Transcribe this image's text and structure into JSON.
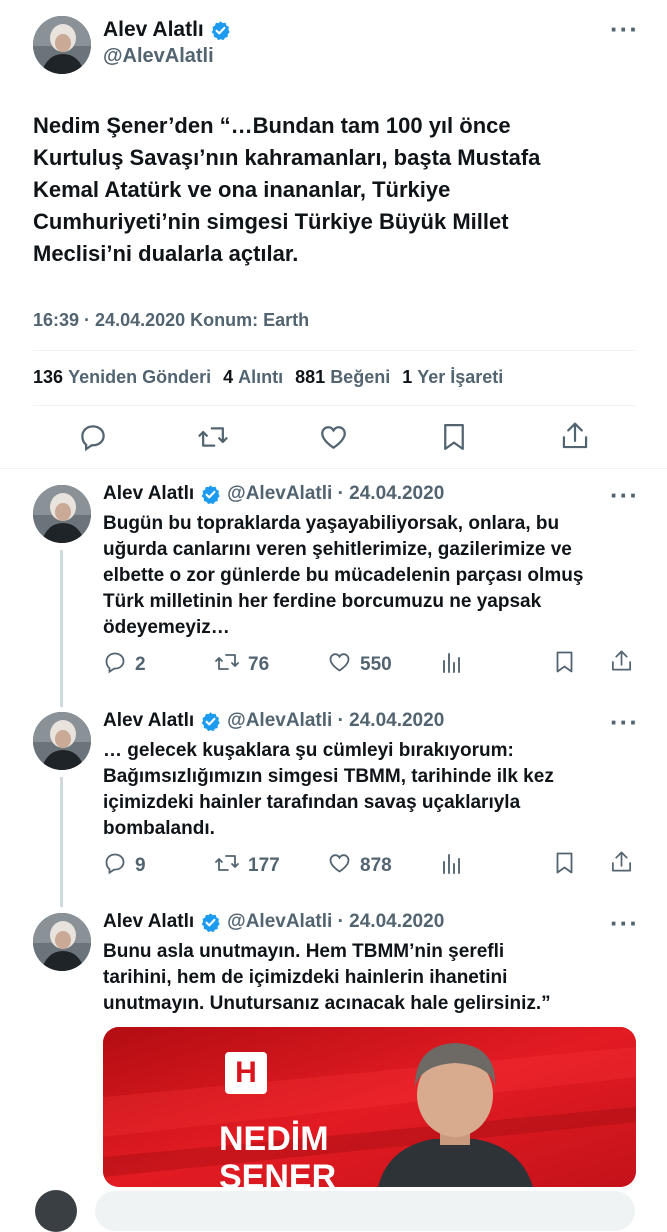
{
  "main_tweet": {
    "author_name": "Alev Alatlı",
    "handle": "@AlevAlatli",
    "text_lines": [
      "Nedim Şener’den “…Bundan tam 100 yıl önce",
      "Kurtuluş Savaşı’nın kahramanları, başta Mustafa",
      "Kemal Atatürk ve ona inananlar, Türkiye",
      "Cumhuriyeti’nin simgesi Türkiye Büyük Millet",
      "Meclisi’ni dualarla açtılar."
    ],
    "time": "16:39",
    "date": "24.04.2020",
    "location_label": "Konum:",
    "location": "Earth",
    "stats": {
      "reposts": "136",
      "reposts_label": "Yeniden Gönderi",
      "quotes": "4",
      "quotes_label": "Alıntı",
      "likes": "881",
      "likes_label": "Beğeni",
      "bookmarks": "1",
      "bookmarks_label": "Yer İşareti"
    }
  },
  "replies": [
    {
      "author_name": "Alev Alatlı",
      "handle_date": "@AlevAlatli · 24.04.2020",
      "text_lines": [
        "Bugün bu topraklarda yaşayabiliyorsak, onlara, bu",
        "uğurda canlarını veren şehitlerimize, gazilerimize ve",
        "elbette o zor günlerde bu mücadelenin parçası olmuş",
        "Türk milletinin her ferdine borcumuzu ne yapsak",
        "ödeyemeyiz…"
      ],
      "replies": "2",
      "reposts": "76",
      "likes": "550"
    },
    {
      "author_name": "Alev Alatlı",
      "handle_date": "@AlevAlatli · 24.04.2020",
      "text_lines": [
        "… gelecek kuşaklara şu cümleyi bırakıyorum:",
        "Bağımsızlığımızın simgesi TBMM, tarihinde ilk kez",
        "içimizdeki hainler tarafından savaş uçaklarıyla",
        "bombalandı."
      ],
      "replies": "9",
      "reposts": "177",
      "likes": "878"
    },
    {
      "author_name": "Alev Alatlı",
      "handle_date": "@AlevAlatli · 24.04.2020",
      "text_lines": [
        "Bunu asla unutmayın. Hem TBMM’nin şerefli",
        "tarihini, hem de içimizdeki hainlerin ihanetini",
        "unutmayın. Unutursanız acınacak hale gelirsiniz.”"
      ]
    }
  ],
  "media": {
    "logo_text": "H",
    "title_line1": "NEDİM",
    "title_line2": "ŞENER"
  },
  "icons": [
    "verified-badge-icon",
    "more-icon",
    "reply-icon",
    "repost-icon",
    "like-icon",
    "bookmark-icon",
    "share-icon",
    "views-icon"
  ],
  "colors": {
    "verified": "#1d9bf0",
    "text": "#0f1419",
    "muted": "#536471",
    "media_red": "#d9141c"
  }
}
